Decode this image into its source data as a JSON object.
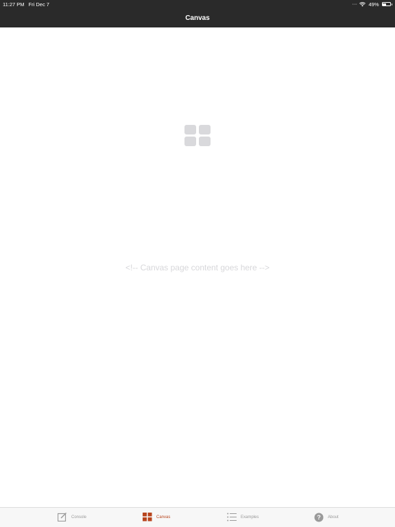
{
  "status_bar": {
    "time": "11:27 PM",
    "date": "Fri Dec 7",
    "battery": "49%",
    "battery_level": 0.49,
    "icons": [
      "wifi-icon",
      "battery-icon"
    ]
  },
  "nav": {
    "title": "Canvas"
  },
  "content": {
    "placeholder": "<!-- Canvas page content goes here -->"
  },
  "tabs": [
    {
      "label": "Console",
      "icon": "compose-icon",
      "active": false
    },
    {
      "label": "Canvas",
      "icon": "grid-icon",
      "active": true
    },
    {
      "label": "Examples",
      "icon": "list-icon",
      "active": false
    },
    {
      "label": "About",
      "icon": "question-icon",
      "active": false
    }
  ],
  "colors": {
    "bar": "#2a2a2a",
    "accent": "#b8461f",
    "tab_inactive": "#9a9a9a"
  }
}
